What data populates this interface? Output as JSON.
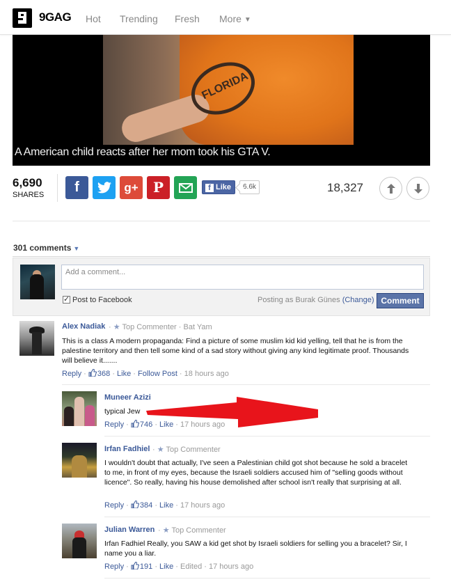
{
  "nav": {
    "logo": "9GAG",
    "items": [
      "Hot",
      "Trending",
      "Fresh",
      "More"
    ]
  },
  "video": {
    "caption": "A American child reacts after her mom took his GTA V.",
    "shirt_text": "FLORIDA"
  },
  "shares": {
    "count": "6,690",
    "label": "SHARES",
    "buttons": [
      "facebook-icon",
      "twitter-icon",
      "google-plus-icon",
      "pinterest-icon",
      "email-icon"
    ],
    "fb_like": "Like",
    "fb_like_count": "6.6k",
    "points": "18,327"
  },
  "comments": {
    "count_label": "301 comments",
    "compose": {
      "placeholder": "Add a comment...",
      "post_to_facebook": "Post to Facebook",
      "posting_as": "Posting as Burak Günes",
      "change": "(Change)",
      "submit": "Comment"
    },
    "list": [
      {
        "name": "Alex Nadiak",
        "badge": "Top Commenter",
        "location": "Bat Yam",
        "text": "This is a class A modern propaganda: Find a picture of some muslim kid kid yelling, tell that he is from the palestine territory and then tell some kind of a sad story without giving any kind legitimate proof. Thousands will believe it.......",
        "reply": "Reply",
        "likes": "368",
        "like": "Like",
        "follow": "Follow Post",
        "time": "18 hours ago"
      },
      {
        "name": "Muneer Azizi",
        "text": "typical Jew",
        "reply": "Reply",
        "likes": "746",
        "like": "Like",
        "time": "17 hours ago"
      },
      {
        "name": "Irfan Fadhiel",
        "badge": "Top Commenter",
        "text": "I wouldn't doubt that actually, I've seen a Palestinian child got shot because he sold a bracelet to me, in front of my eyes, because the Israeli soldiers accused him of \"selling goods without licence\". So really, having his house demolished after school isn't really that surprising at all.",
        "reply": "Reply",
        "likes": "384",
        "like": "Like",
        "time": "17 hours ago"
      },
      {
        "name": "Julian Warren",
        "badge": "Top Commenter",
        "text": "Irfan Fadhiel Really, you SAW a kid get shot by Israeli soldiers for selling you a bracelet? Sir, I name you a liar.",
        "reply": "Reply",
        "likes": "191",
        "like": "Like",
        "edited": "Edited",
        "time": "17 hours ago"
      }
    ]
  },
  "colors": {
    "facebook": "#3b5998",
    "twitter": "#1da1f2",
    "google_plus": "#dd4b39",
    "pinterest": "#cb2027",
    "email": "#23a455",
    "annotation_arrow": "#e8141b"
  }
}
